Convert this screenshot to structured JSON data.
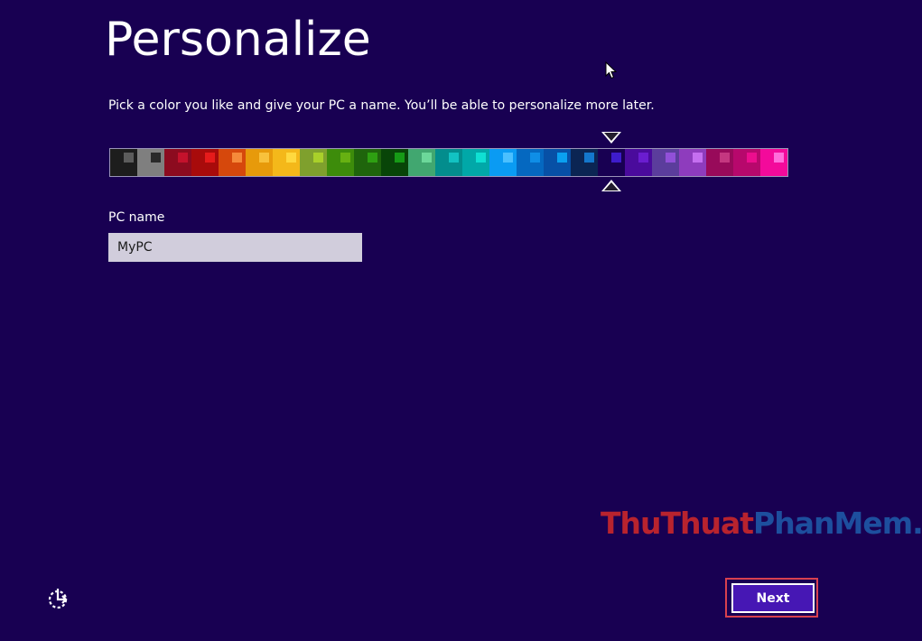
{
  "page": {
    "title": "Personalize",
    "subtitle": "Pick a color you like and give your PC a name. You’ll be able to personalize more later."
  },
  "palette": {
    "selected_index": 18,
    "swatches": [
      {
        "bg": "#1d1d1d",
        "chip": "#5c5c5c"
      },
      {
        "bg": "#7f7f7f",
        "chip": "#2a2a2a"
      },
      {
        "bg": "#8c0b1f",
        "chip": "#c4122c"
      },
      {
        "bg": "#a80b0b",
        "chip": "#e61b1b"
      },
      {
        "bg": "#d6480c",
        "chip": "#f58a3a"
      },
      {
        "bg": "#e79a0b",
        "chip": "#f8c23c"
      },
      {
        "bg": "#f4b81a",
        "chip": "#ffd93f"
      },
      {
        "bg": "#7fa02d",
        "chip": "#a9d02a"
      },
      {
        "bg": "#3d8c0b",
        "chip": "#67b112"
      },
      {
        "bg": "#1f650c",
        "chip": "#2ea012"
      },
      {
        "bg": "#084508",
        "chip": "#169a16"
      },
      {
        "bg": "#41a770",
        "chip": "#6cd89a"
      },
      {
        "bg": "#038d8d",
        "chip": "#12c2c2"
      },
      {
        "bg": "#01a8a8",
        "chip": "#0fe0d3"
      },
      {
        "bg": "#0a9bf3",
        "chip": "#4bc0ff"
      },
      {
        "bg": "#0568c0",
        "chip": "#0f8ee6"
      },
      {
        "bg": "#0750a6",
        "chip": "#0aa0f0"
      },
      {
        "bg": "#0b2553",
        "chip": "#1477cc"
      },
      {
        "bg": "#180052",
        "chip": "#3e1ccc"
      },
      {
        "bg": "#4a0b9c",
        "chip": "#6a1dd0"
      },
      {
        "bg": "#5b3d9c",
        "chip": "#9150d8"
      },
      {
        "bg": "#8e3cbd",
        "chip": "#c56ff0"
      },
      {
        "bg": "#980a5a",
        "chip": "#c43780"
      },
      {
        "bg": "#b7086c",
        "chip": "#ec0e8d"
      },
      {
        "bg": "#f30a9b",
        "chip": "#ff6ddb"
      }
    ]
  },
  "pc_name": {
    "label": "PC name",
    "value": "MyPC"
  },
  "watermark": {
    "part_a": "ThuThuat",
    "part_b": "PhanMem",
    "part_c": ".vn"
  },
  "footer": {
    "next_label": "Next",
    "ease_of_access_icon": "ease-of-access-icon"
  },
  "colors": {
    "background": "#180052",
    "next_button": "#4617b4",
    "focus_outline": "#d8404f"
  }
}
